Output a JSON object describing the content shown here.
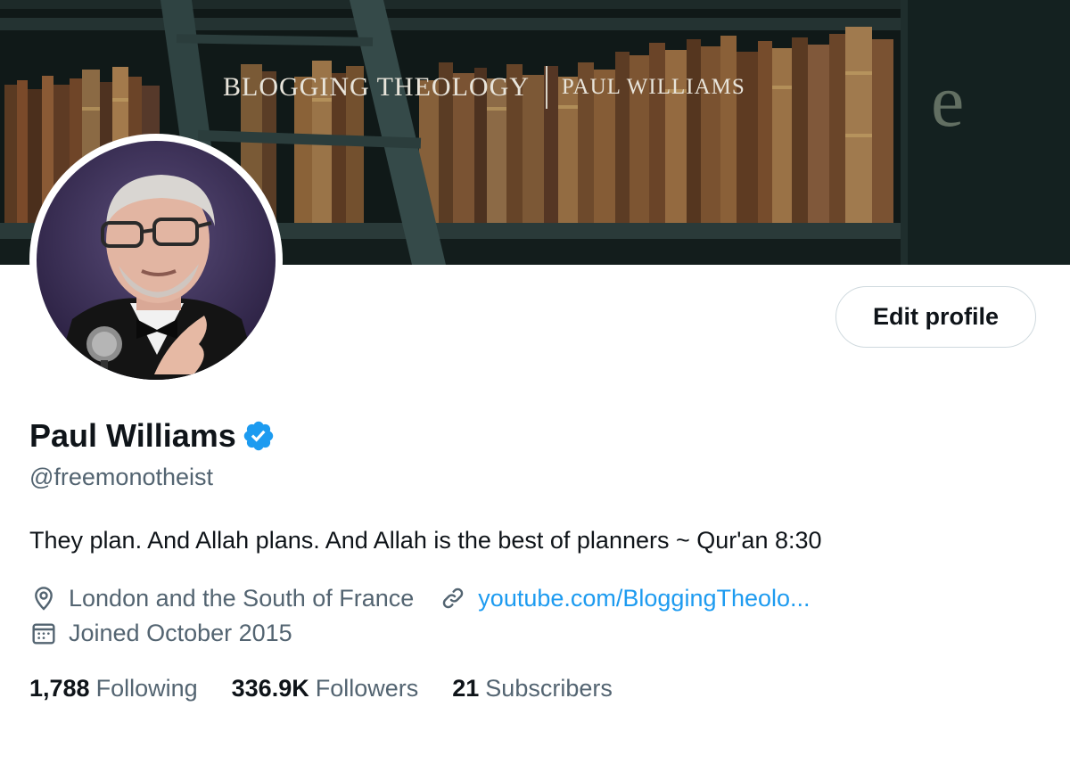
{
  "banner": {
    "title_main": "BLOGGING THEOLOGY",
    "title_sub": "PAUL WILLIAMS",
    "corner_letter": "e"
  },
  "profile": {
    "name": "Paul Williams",
    "handle": "@freemonotheist",
    "bio": "They plan. And Allah plans. And Allah is the best of planners ~ Qur'an 8:30",
    "location": "London and the South of France",
    "website": "youtube.com/BloggingTheolo...",
    "joined": "Joined October 2015"
  },
  "actions": {
    "edit_profile": "Edit profile"
  },
  "stats": {
    "following_count": "1,788",
    "following_label": "Following",
    "followers_count": "336.9K",
    "followers_label": "Followers",
    "subscribers_count": "21",
    "subscribers_label": "Subscribers"
  },
  "icons": {
    "verified": "verified-badge-icon",
    "location": "location-pin-icon",
    "link": "link-icon",
    "calendar": "calendar-icon"
  },
  "colors": {
    "accent": "#1d9bf0",
    "secondary_text": "#536471",
    "primary_text": "#0f1419",
    "button_border": "#cfd9de"
  }
}
